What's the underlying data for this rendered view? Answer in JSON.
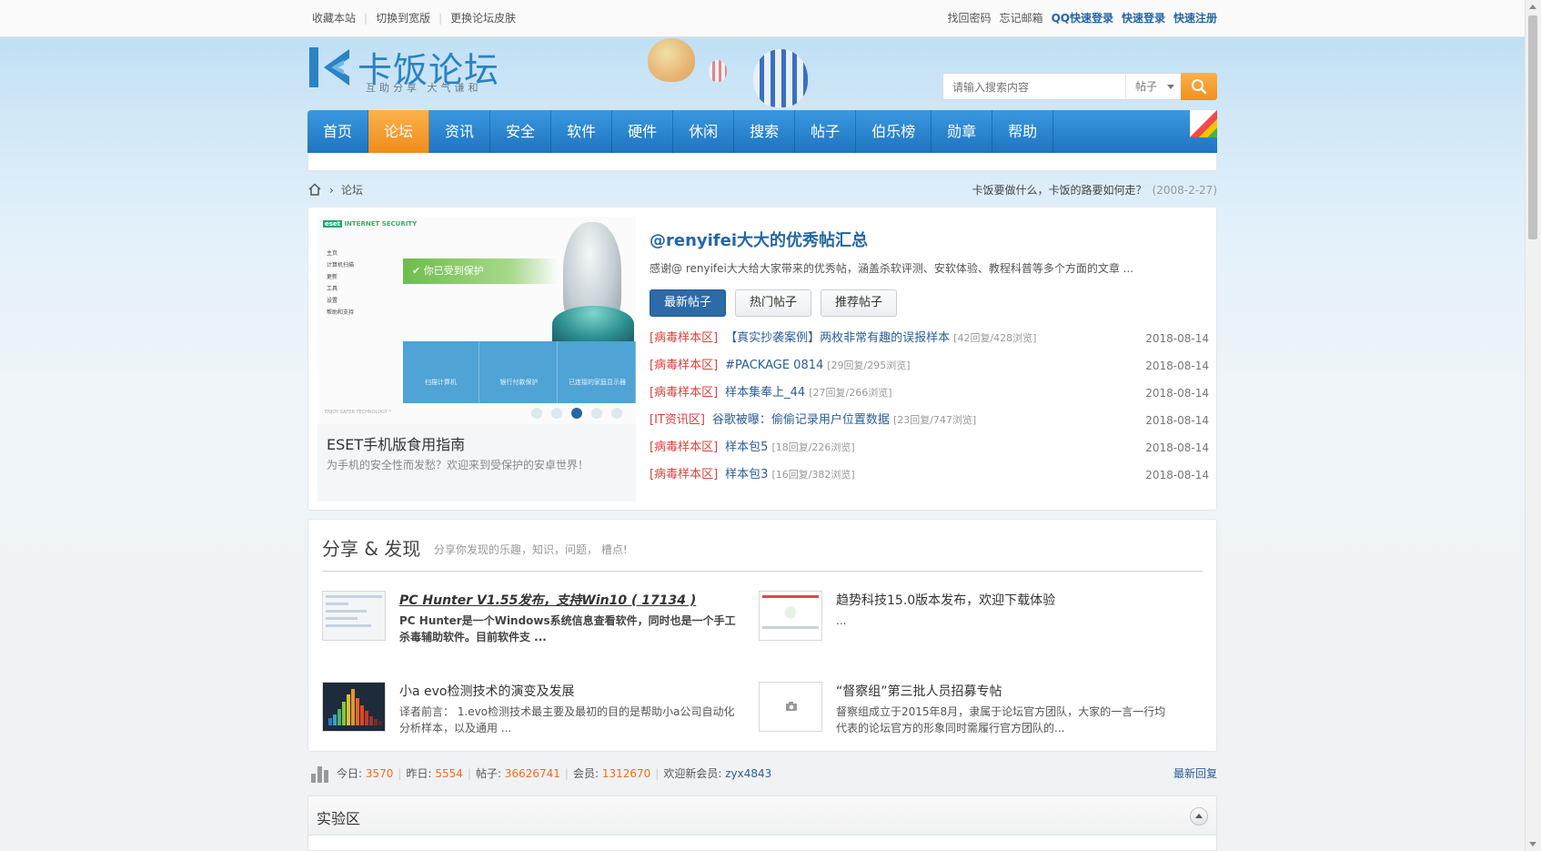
{
  "topbar": {
    "left": [
      "收藏本站",
      "切换到宽版",
      "更换论坛皮肤"
    ],
    "right": [
      {
        "label": "找回密码",
        "strong": false
      },
      {
        "label": "忘记邮箱",
        "strong": false
      },
      {
        "label": "QQ快速登录",
        "strong": true
      },
      {
        "label": "快速登录",
        "strong": true
      },
      {
        "label": "快速注册",
        "strong": true
      }
    ]
  },
  "logo": {
    "name": "卡饭论坛",
    "slogan": "互助分享  大气谦和"
  },
  "search": {
    "placeholder": "请输入搜索内容",
    "type": "帖子"
  },
  "nav": [
    {
      "label": "首页",
      "active": false
    },
    {
      "label": "论坛",
      "active": true
    },
    {
      "label": "资讯",
      "active": false
    },
    {
      "label": "安全",
      "active": false
    },
    {
      "label": "软件",
      "active": false
    },
    {
      "label": "硬件",
      "active": false
    },
    {
      "label": "休闲",
      "active": false
    },
    {
      "label": "搜索",
      "active": false
    },
    {
      "label": "帖子",
      "active": false
    },
    {
      "label": "伯乐榜",
      "active": false
    },
    {
      "label": "勋章",
      "active": false
    },
    {
      "label": "帮助",
      "active": false
    }
  ],
  "breadcrumb": {
    "current": "论坛",
    "announcement": "卡饭要做什么，卡饭的路要如何走？",
    "announcement_date": "(2008-2-27)"
  },
  "slide": {
    "title": "ESET手机版食用指南",
    "desc": "为手机的安全性而发愁？欢迎来到受保护的安卓世界！",
    "screen": {
      "brand_mark": "eset",
      "brand": "INTERNET SECURITY",
      "menu": [
        "主页",
        "计算机扫描",
        "更新",
        "工具",
        "设置",
        "帮助和支持"
      ],
      "protected": "你已受到保护",
      "tiles": [
        "扫描计算机",
        "银行付款保护",
        "已连接的家庭显示器"
      ],
      "footer": "ENJOY SAFER TECHNOLOGY™"
    },
    "dots": 5,
    "active_dot": 3
  },
  "featured": {
    "headline": "@renyifei大大的优秀帖汇总",
    "intro": "感谢@ renyifei大大给大家带来的优秀帖，涵盖杀软评测、安软体验、教程科普等多个方面的文章 ...",
    "tabs": [
      {
        "label": "最新帖子",
        "active": true
      },
      {
        "label": "热门帖子",
        "active": false
      },
      {
        "label": "推荐帖子",
        "active": false
      }
    ],
    "threads": [
      {
        "cat": "[病毒样本区]",
        "title": "【真实抄袭案例】两枚非常有趣的误报样本",
        "stat": "[42回复/428浏览]",
        "date": "2018-08-14"
      },
      {
        "cat": "[病毒样本区]",
        "title": "#PACKAGE 0814",
        "stat": "[29回复/295浏览]",
        "date": "2018-08-14"
      },
      {
        "cat": "[病毒样本区]",
        "title": "样本集奉上_44",
        "stat": "[27回复/266浏览]",
        "date": "2018-08-14"
      },
      {
        "cat": "[IT资讯区]",
        "title": "谷歌被曝：偷偷记录用户位置数据",
        "stat": "[23回复/747浏览]",
        "date": "2018-08-14"
      },
      {
        "cat": "[病毒样本区]",
        "title": "样本包5",
        "stat": "[18回复/226浏览]",
        "date": "2018-08-14"
      },
      {
        "cat": "[病毒样本区]",
        "title": "样本包3",
        "stat": "[16回复/382浏览]",
        "date": "2018-08-14"
      }
    ]
  },
  "share": {
    "title": "分享 & 发现",
    "subtitle": "分享你发现的乐趣，知识，问题，  槽点!",
    "items": [
      {
        "title": "PC Hunter V1.55发布，支持Win10 ( 17134 )",
        "desc": "PC Hunter是一个Windows系统信息查看软件，同时也是一个手工杀毒辅助软件。目前软件支 ..."
      },
      {
        "title": "趋势科技15.0版本发布，欢迎下载体验",
        "desc": "..."
      },
      {
        "title": "小a evo检测技术的演变及发展",
        "desc": "译者前言： 1.evo检测技术最主要及最初的目的是帮助小a公司自动化分析样本，以及通用 ..."
      },
      {
        "title": "“督察组”第三批人员招募专帖",
        "desc": "督察组成立于2015年8月，隶属于论坛官方团队，大家的一言一行均代表的论坛官方的形象同时需履行官方团队的..."
      }
    ]
  },
  "stats": {
    "today_label": "今日:",
    "today": "3570",
    "yesterday_label": "昨日:",
    "yesterday": "5554",
    "posts_label": "帖子:",
    "posts": "36626741",
    "members_label": "会员:",
    "members": "1312670",
    "newest_label": "欢迎新会员:",
    "newest": "zyx4843",
    "latest_reply": "最新回复"
  },
  "section": {
    "title": "实验区"
  },
  "colors": {
    "nav_blue": "#2b86d2",
    "nav_active": "#f5a031",
    "link": "#2467a4",
    "category": "#d9403a",
    "number": "#f26c1f"
  }
}
